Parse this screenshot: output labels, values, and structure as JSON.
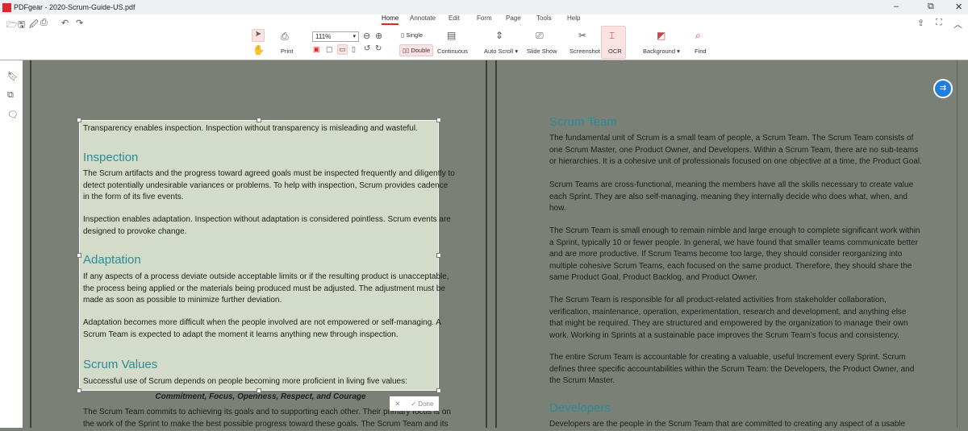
{
  "app": {
    "title": "PDFgear - 2020-Scrum-Guide-US.pdf",
    "logo": "PDF"
  },
  "menu_tabs": [
    "Home",
    "Annotate",
    "Edit",
    "Form",
    "Page",
    "Tools",
    "Help"
  ],
  "toolbar": {
    "zoom": "111%",
    "print": "Print",
    "single": "Single",
    "double": "Double",
    "continuous": "Continuous",
    "auto_scroll": "Auto Scroll ▾",
    "slide_show": "Slide Show",
    "screenshot": "Screenshot",
    "ocr": "OCR",
    "background": "Background ▾",
    "find": "Find"
  },
  "colors": {
    "accent": "#e0262a",
    "heading": "#2b8b98",
    "selection": "#d3dcc9",
    "page_dim": "#7b8077"
  },
  "ocr_popup": {
    "cancel": "✕",
    "done": "Done"
  },
  "left_page": {
    "p0": [
      "Transparency enables inspection. Inspection without transparency is misleading and wasteful."
    ],
    "h1": "Inspection",
    "p1": [
      "The Scrum artifacts and the progress toward agreed goals must be inspected frequently and diligently to",
      "detect potentially undesirable variances or problems. To help with inspection, Scrum provides cadence",
      "in the form of its five events."
    ],
    "p2": [
      "Inspection enables adaptation. Inspection without adaptation is considered pointless. Scrum events are",
      "designed to provoke change."
    ],
    "h2": "Adaptation",
    "p3": [
      "If any aspects of a process deviate outside acceptable limits or if the resulting product is unacceptable,",
      "the process being applied or the materials being produced must be adjusted. The adjustment must be",
      "made as soon as possible to minimize further deviation."
    ],
    "p4": [
      "Adaptation becomes more difficult when the people involved are not empowered or self-managing. A",
      "Scrum Team is expected to adapt the moment it learns anything new through inspection."
    ],
    "h3": "Scrum Values",
    "p5": [
      "Successful use of Scrum depends on people becoming more proficient in living five values:"
    ],
    "values": "Commitment, Focus, Openness, Respect, and Courage",
    "p6": [
      "The Scrum Team commits to achieving its goals and to supporting each other. Their primary focus is on",
      "the work of the Sprint to make the best possible progress toward these goals. The Scrum Team and its"
    ]
  },
  "right_page": {
    "h1": "Scrum Team",
    "p1": [
      "The fundamental unit of Scrum is a small team of people, a Scrum Team. The Scrum Team consists of",
      "one Scrum Master, one Product Owner, and Developers. Within a Scrum Team, there are no sub-teams",
      "or hierarchies. It is a cohesive unit of professionals focused on one objective at a time, the Product Goal."
    ],
    "p2": [
      "Scrum Teams are cross-functional, meaning the members have all the skills necessary to create value",
      "each Sprint. They are also self-managing, meaning they internally decide who does what, when, and",
      "how."
    ],
    "p3": [
      "The Scrum Team is small enough to remain nimble and large enough to complete significant work within",
      "a Sprint, typically 10 or fewer people. In general, we have found that smaller teams communicate better",
      "and are more productive. If Scrum Teams become too large, they should consider reorganizing into",
      "multiple cohesive Scrum Teams, each focused on the same product. Therefore, they should share the",
      "same Product Goal, Product Backlog, and Product Owner."
    ],
    "p4": [
      "The Scrum Team is responsible for all product-related activities from stakeholder collaboration,",
      "verification, maintenance, operation, experimentation, research and development, and anything else",
      "that might be required. They are structured and empowered by the organization to manage their own",
      "work. Working in Sprints at a sustainable pace improves the Scrum Team’s focus and consistency."
    ],
    "p5": [
      "The entire Scrum Team is accountable for creating a valuable, useful Increment every Sprint. Scrum",
      "defines three specific accountabilities within the Scrum Team: the Developers, the Product Owner, and",
      "the Scrum Master."
    ],
    "h2": "Developers",
    "p6": [
      "Developers are the people in the Scrum Team that are committed to creating any aspect of a usable"
    ]
  }
}
